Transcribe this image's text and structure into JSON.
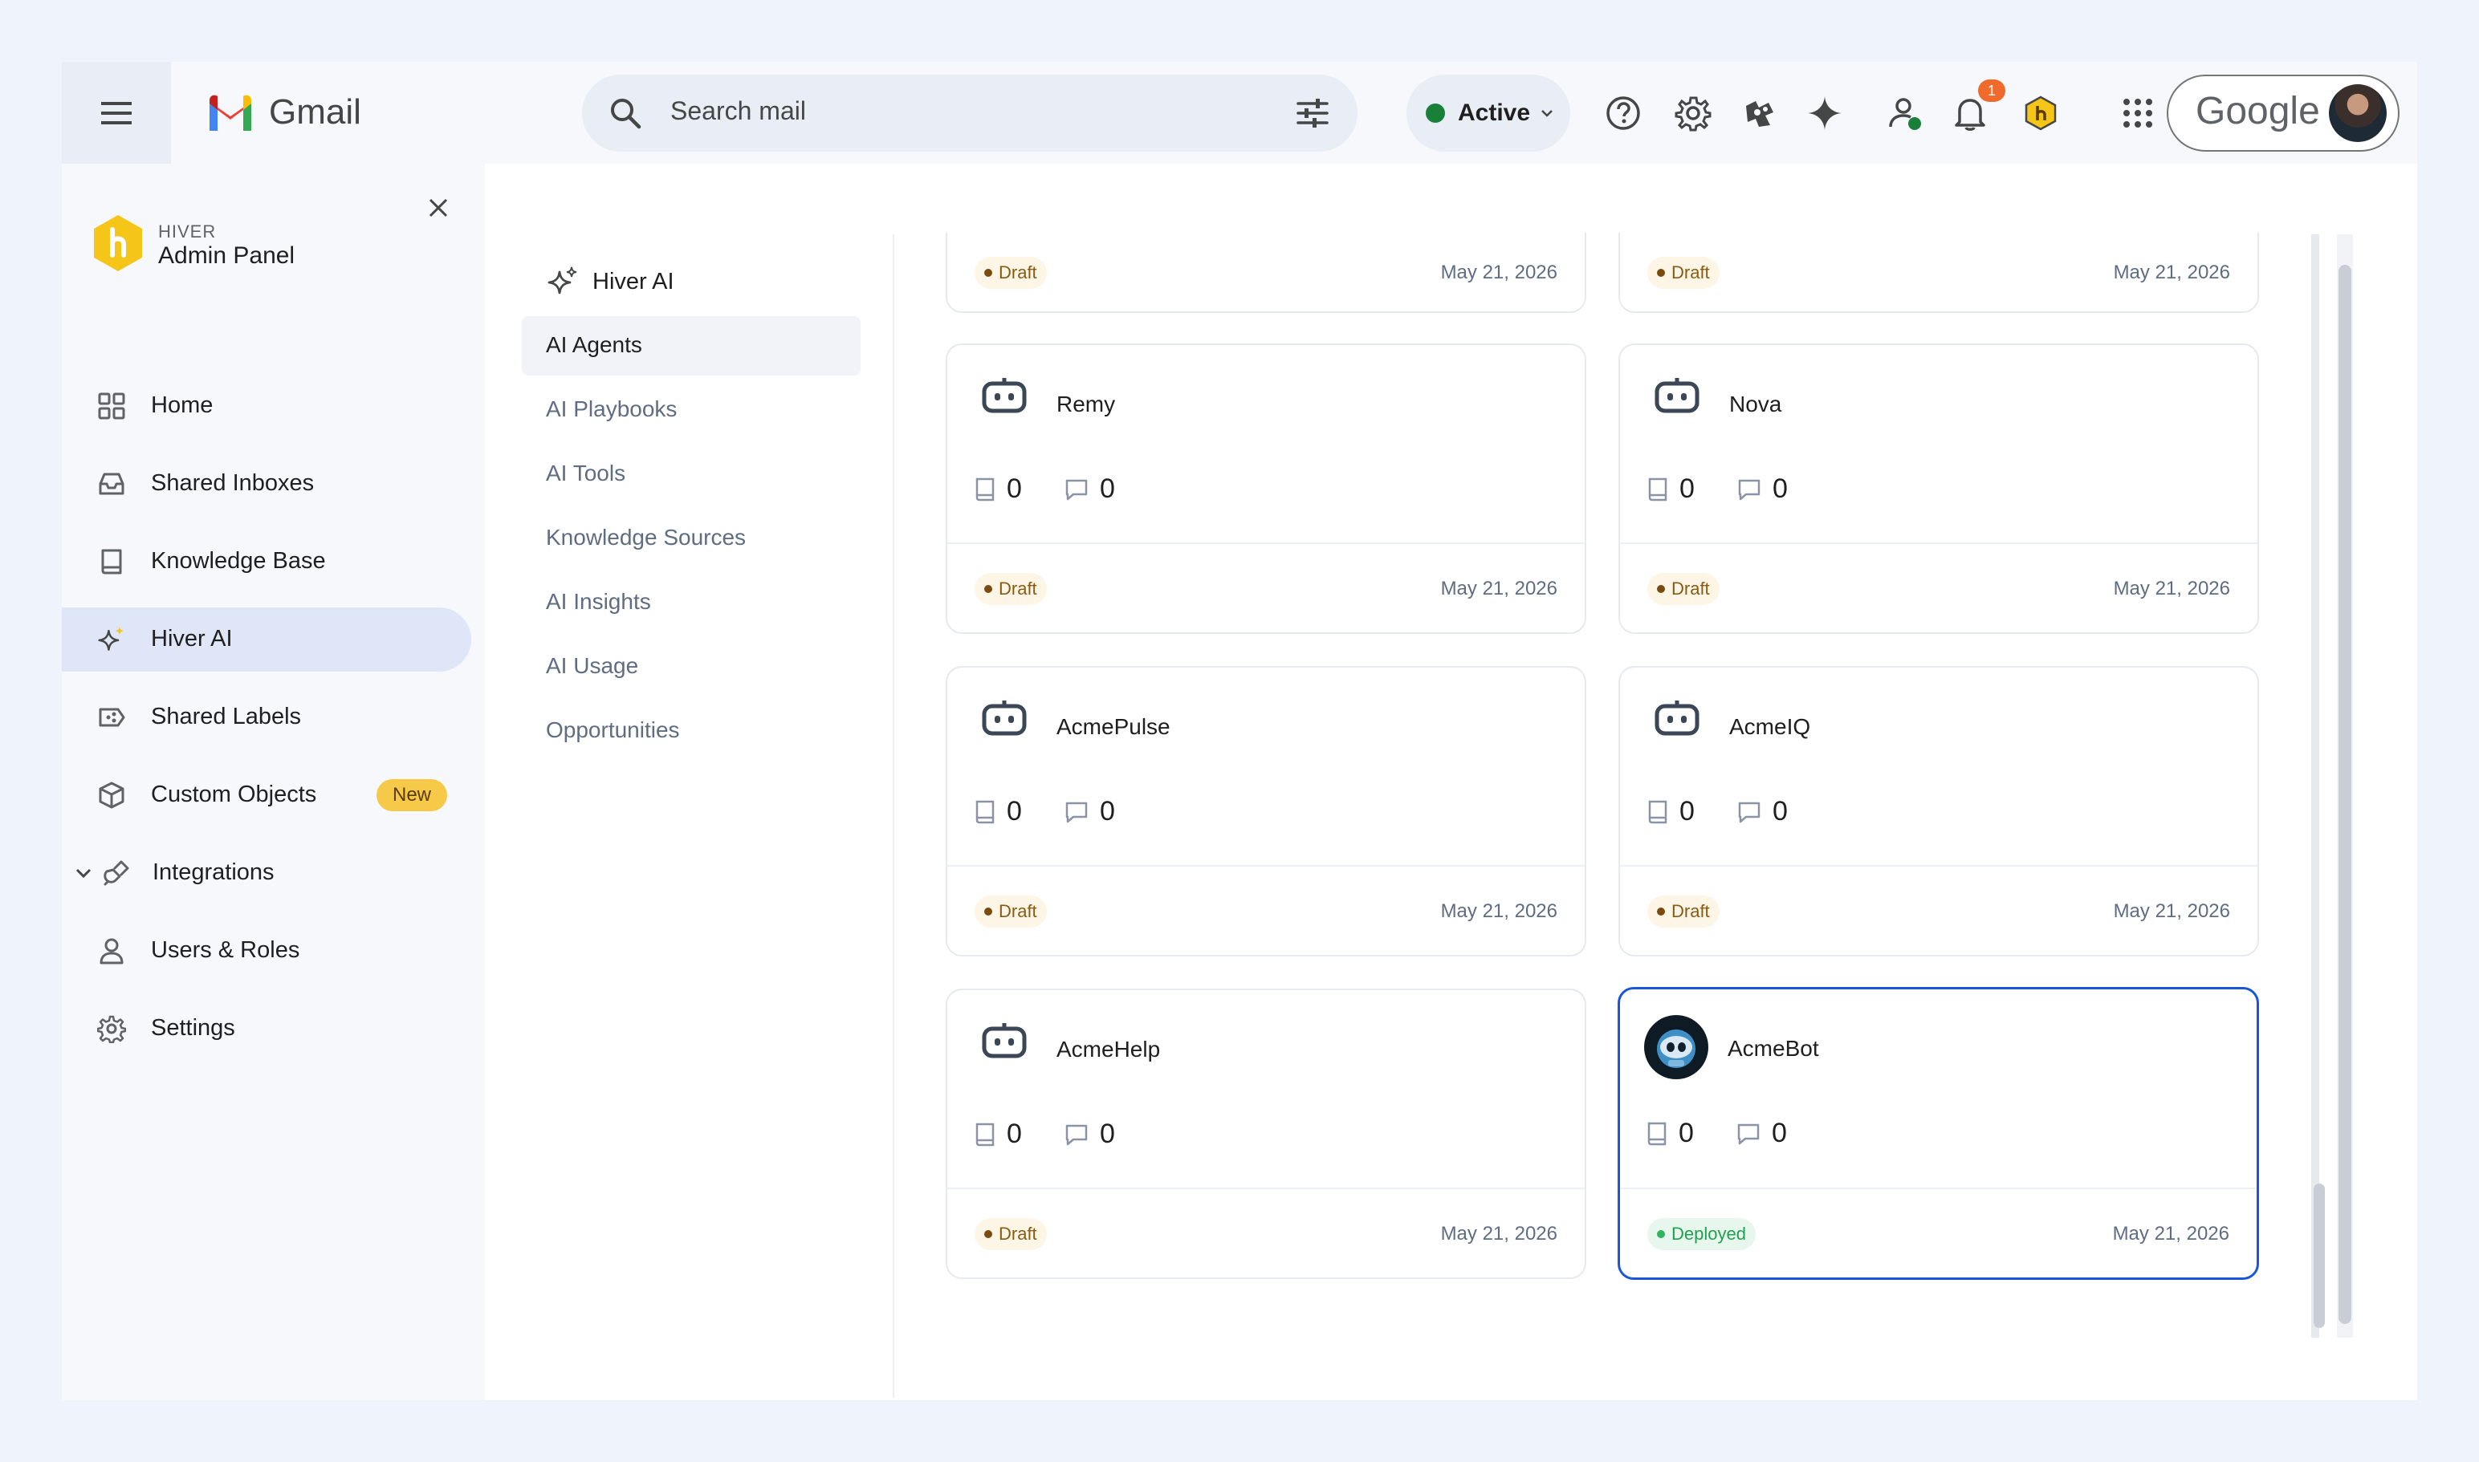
{
  "gmail": {
    "app_name": "Gmail",
    "search_placeholder": "Search mail",
    "status": "Active",
    "notification_count": "1",
    "account_brand": "Google"
  },
  "sidebar": {
    "brand_small": "HIVER",
    "brand_title": "Admin Panel",
    "items": [
      {
        "label": "Home",
        "icon": "grid-icon"
      },
      {
        "label": "Shared Inboxes",
        "icon": "inbox-icon"
      },
      {
        "label": "Knowledge Base",
        "icon": "book-icon"
      },
      {
        "label": "Hiver AI",
        "icon": "sparkle-icon"
      },
      {
        "label": "Shared Labels",
        "icon": "label-icon"
      },
      {
        "label": "Custom Objects",
        "icon": "cube-icon",
        "badge": "New"
      },
      {
        "label": "Integrations",
        "icon": "plug-icon"
      },
      {
        "label": "Users & Roles",
        "icon": "user-icon"
      },
      {
        "label": "Settings",
        "icon": "gear-icon"
      }
    ],
    "selected": "Hiver AI"
  },
  "subnav": {
    "title": "Hiver AI",
    "items": [
      "AI Agents",
      "AI Playbooks",
      "AI Tools",
      "Knowledge Sources",
      "AI Insights",
      "AI Usage",
      "Opportunities"
    ],
    "selected": "AI Agents"
  },
  "agents": {
    "partial_top": [
      {
        "status": "Draft",
        "date": "May 21, 2026"
      },
      {
        "status": "Draft",
        "date": "May 21, 2026"
      }
    ],
    "cards": [
      {
        "name": "Remy",
        "knowledge": "0",
        "conversations": "0",
        "status": "Draft",
        "date": "May 21, 2026"
      },
      {
        "name": "Nova",
        "knowledge": "0",
        "conversations": "0",
        "status": "Draft",
        "date": "May 21, 2026"
      },
      {
        "name": "AcmePulse",
        "knowledge": "0",
        "conversations": "0",
        "status": "Draft",
        "date": "May 21, 2026"
      },
      {
        "name": "AcmeIQ",
        "knowledge": "0",
        "conversations": "0",
        "status": "Draft",
        "date": "May 21, 2026"
      },
      {
        "name": "AcmeHelp",
        "knowledge": "0",
        "conversations": "0",
        "status": "Draft",
        "date": "May 21, 2026"
      },
      {
        "name": "AcmeBot",
        "knowledge": "0",
        "conversations": "0",
        "status": "Deployed",
        "date": "May 21, 2026"
      }
    ]
  },
  "colors": {
    "accent": "#1a56db",
    "draft": "#8a5a12",
    "deployed": "#21a04f",
    "brand_yellow": "#f5c518"
  }
}
